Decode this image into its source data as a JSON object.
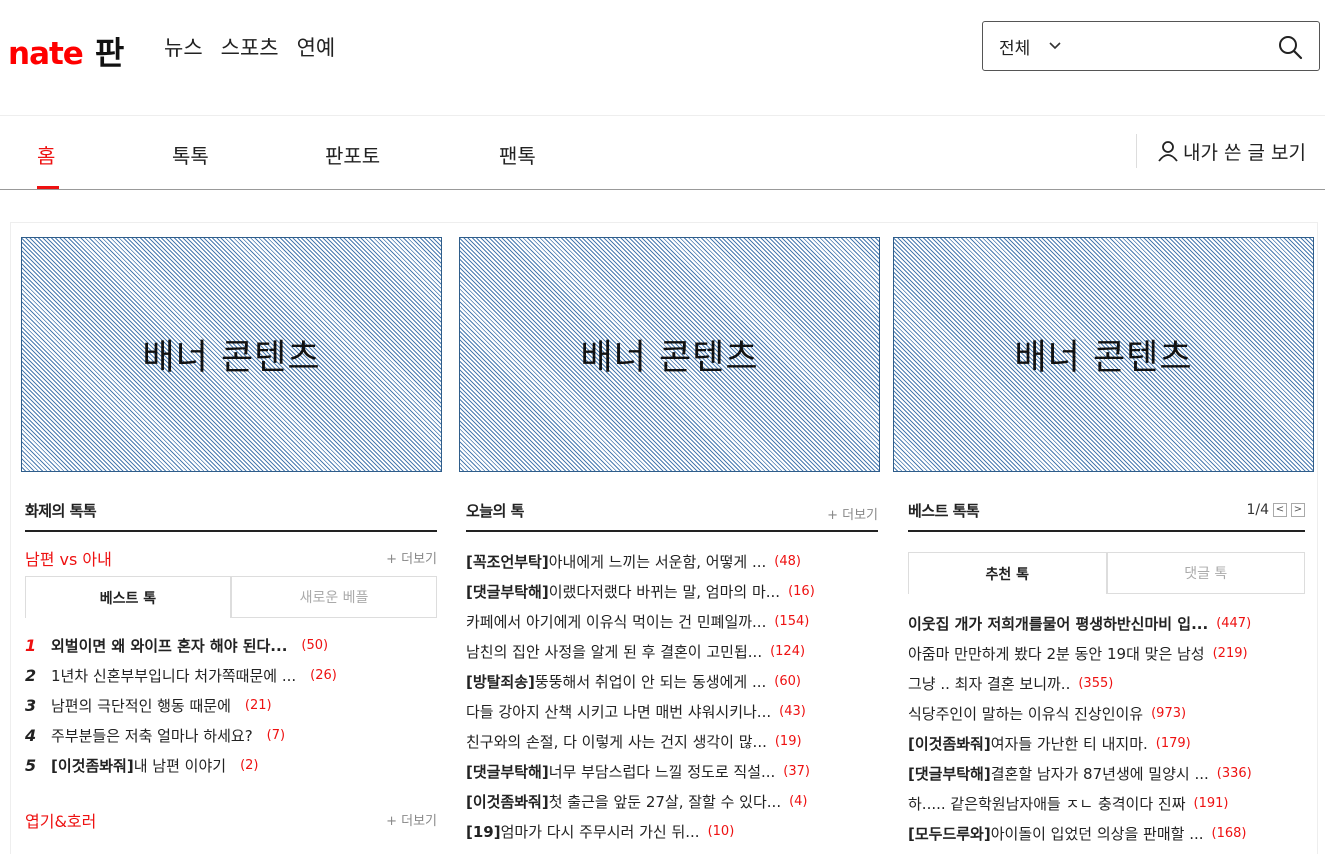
{
  "header": {
    "logo_brand": "nate",
    "logo_service": "판",
    "nav": [
      "뉴스",
      "스포츠",
      "연예"
    ],
    "search": {
      "scope": "전체",
      "placeholder": ""
    }
  },
  "tabs": {
    "items": [
      "홈",
      "톡톡",
      "판포토",
      "팬톡"
    ],
    "active": 0,
    "my_posts": "내가 쓴 글 보기"
  },
  "banners": [
    "배너 콘텐츠",
    "배너 콘텐츠",
    "배너 콘텐츠"
  ],
  "hot_talk": {
    "title": "화제의 톡톡",
    "category": "남편 vs 아내",
    "more": "+ 더보기",
    "subtabs": [
      "베스트 톡",
      "새로운 베플"
    ],
    "items": [
      {
        "rank": "1",
        "title": "외벌이면 왜 와이프 혼자 해야 된다...",
        "count": "(50)"
      },
      {
        "rank": "2",
        "title": "1년차 신혼부부입니다 처가쪽때문에 ...",
        "count": "(26)"
      },
      {
        "rank": "3",
        "title": "남편의 극단적인 행동 때문에",
        "count": "(21)"
      },
      {
        "rank": "4",
        "title": "주부분들은 저축 얼마나 하세요?",
        "count": "(7)"
      },
      {
        "rank": "5",
        "tag": "[이것좀봐줘]",
        "title": " 내 남편 이야기",
        "count": "(2)"
      }
    ],
    "next_category": "엽기&호러",
    "next_more": "+ 더보기"
  },
  "today_talk": {
    "title": "오늘의 톡",
    "more": "+ 더보기",
    "items": [
      {
        "tag": "[꼭조언부탁]",
        "title": "아내에게 느끼는 서운함, 어떻게 ...",
        "count": "(48)"
      },
      {
        "tag": "[댓글부탁해]",
        "title": "이랬다저랬다 바뀌는 말, 엄마의 마...",
        "count": "(16)"
      },
      {
        "tag": "",
        "title": "카페에서 아기에게 이유식 먹이는 건 민폐일까...",
        "count": "(154)"
      },
      {
        "tag": "",
        "title": "남친의 집안 사정을 알게 된 후 결혼이 고민됩...",
        "count": "(124)"
      },
      {
        "tag": "[방탈죄송]",
        "title": "뚱뚱해서 취업이 안 되는 동생에게 ...",
        "count": "(60)"
      },
      {
        "tag": "",
        "title": "다들 강아지 산책 시키고 나면 매번 샤워시키나...",
        "count": "(43)"
      },
      {
        "tag": "",
        "title": "친구와의 손절, 다 이렇게 사는 건지 생각이 많...",
        "count": "(19)"
      },
      {
        "tag": "[댓글부탁해]",
        "title": "너무 부담스럽다 느낄 정도로 직설...",
        "count": "(37)"
      },
      {
        "tag": "[이것좀봐줘]",
        "title": "첫 출근을 앞둔 27살, 잘할 수 있다...",
        "count": "(4)"
      },
      {
        "tag": "[19]",
        "title": "엄마가 다시 주무시러 가신 뒤...",
        "count": "(10)"
      }
    ]
  },
  "best_talk": {
    "title": "베스트 톡톡",
    "page": "1/4",
    "prev": "<",
    "next": ">",
    "subtabs": [
      "추천 톡",
      "댓글 톡"
    ],
    "items": [
      {
        "tag": "",
        "title": "이웃집 개가 저희개를물어 평생하반신마비 입...",
        "count": "(447)",
        "bold": true
      },
      {
        "tag": "",
        "title": "아줌마 만만하게 봤다 2분 동안 19대 맞은 남성",
        "count": "(219)"
      },
      {
        "tag": "",
        "title": "그냥 .. 최자 결혼 보니까..",
        "count": "(355)"
      },
      {
        "tag": "",
        "title": "식당주인이 말하는 이유식 진상인이유",
        "count": "(973)"
      },
      {
        "tag": "[이것좀봐줘]",
        "title": "여자들 가난한 티 내지마.",
        "count": "(179)"
      },
      {
        "tag": "[댓글부탁해]",
        "title": "결혼할 남자가 87년생에 밀양시 ...",
        "count": "(336)"
      },
      {
        "tag": "",
        "title": "하..... 같은학원남자애들 ㅈㄴ 충격이다 진짜",
        "count": "(191)"
      },
      {
        "tag": "[모두드루와]",
        "title": "아이돌이 입었던 의상을 판매할 ...",
        "count": "(168)"
      }
    ]
  },
  "colors": {
    "accent": "#e11111",
    "banner_stripe": "#4a7bb0"
  }
}
